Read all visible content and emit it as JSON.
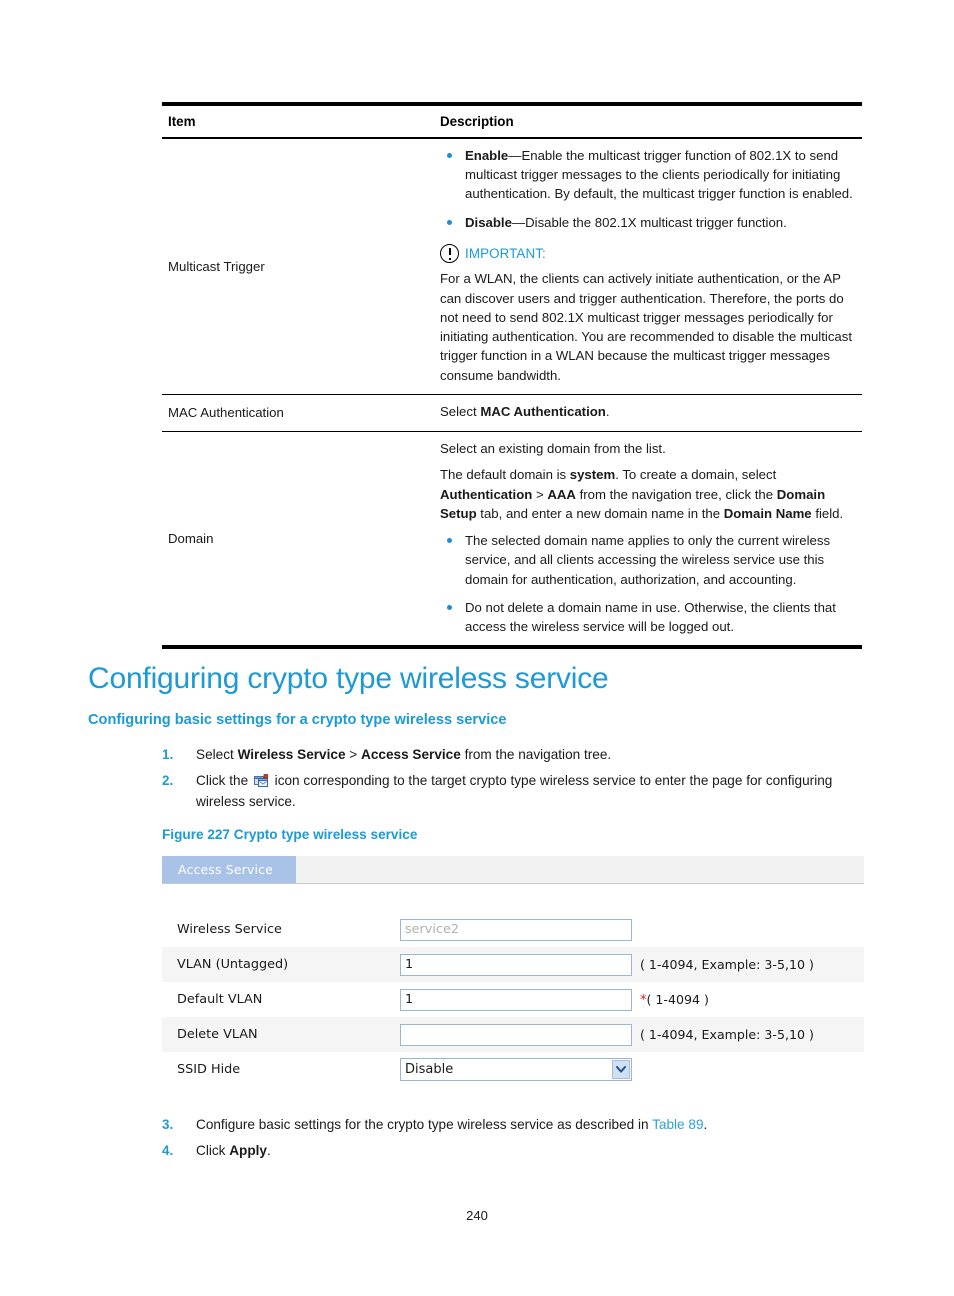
{
  "table": {
    "headers": {
      "item": "Item",
      "description": "Description"
    },
    "rows": [
      {
        "item": "Multicast Trigger",
        "bullets": [
          {
            "term": "Enable",
            "dash": "—",
            "text": "Enable the multicast trigger function of 802.1X to send multicast trigger messages to the clients periodically for initiating authentication. By default, the multicast trigger function is enabled."
          },
          {
            "term": "Disable",
            "dash": "—",
            "text": "Disable the 802.1X multicast trigger function."
          }
        ],
        "note": {
          "icon": "exclamation-circle-icon",
          "label": "IMPORTANT:",
          "text": "For a WLAN, the clients can actively initiate authentication, or the AP can discover users and trigger authentication. Therefore, the ports do not need to send 802.1X multicast trigger messages periodically for initiating authentication. You are recommended to disable the multicast trigger function in a WLAN because the multicast trigger messages consume bandwidth."
        }
      },
      {
        "item": "MAC Authentication",
        "desc_pre": "Select ",
        "desc_bold": "MAC Authentication",
        "desc_post": "."
      },
      {
        "item": "Domain",
        "para1": "Select an existing domain from the list.",
        "para2_a": "The default domain is ",
        "para2_b": "system",
        "para2_c": ". To create a domain, select ",
        "para2_d": "Authentication",
        "para2_e": " > ",
        "para2_f": "AAA",
        "para2_g": " from the navigation tree, click the ",
        "para2_h": "Domain Setup",
        "para2_i": " tab, and enter a new domain name in the ",
        "para2_j": "Domain Name",
        "para2_k": " field.",
        "bullets": [
          "The selected domain name applies to only the current wireless service, and all clients accessing the wireless service use this domain for authentication, authorization, and accounting.",
          "Do not delete a domain name in use. Otherwise, the clients that access the wireless service will be logged out."
        ]
      }
    ]
  },
  "section": {
    "heading1": "Configuring crypto type wireless service",
    "heading2": "Configuring basic settings for a crypto type wireless service",
    "figure_caption": "Figure 227 Crypto type wireless service"
  },
  "steps_top": [
    {
      "num": "1.",
      "pre": "Select ",
      "bold1": "Wireless Service",
      "mid": " > ",
      "bold2": "Access Service",
      "post": " from the navigation tree."
    },
    {
      "num": "2.",
      "pre": "Click the ",
      "icon": "wireless-service-config-icon",
      "post": " icon corresponding to the target crypto type wireless service to enter the page for configuring wireless service."
    }
  ],
  "steps_bottom": [
    {
      "num": "3.",
      "pre": "Configure basic settings for the crypto type wireless service as described in ",
      "link": "Table 89",
      "post": "."
    },
    {
      "num": "4.",
      "pre": "Click ",
      "bold1": "Apply",
      "post": "."
    }
  ],
  "screenshot": {
    "tab_label": "Access Service",
    "fields": [
      {
        "label": "Wireless Service",
        "type": "text",
        "value": "service2",
        "disabled": true,
        "hint": ""
      },
      {
        "label": "VLAN (Untagged)",
        "type": "text",
        "value": "1",
        "disabled": false,
        "hint": "( 1-4094, Example: 3-5,10 )"
      },
      {
        "label": "Default VLAN",
        "type": "text",
        "value": "1",
        "disabled": false,
        "required_mark": "*",
        "hint": "( 1-4094 )"
      },
      {
        "label": "Delete VLAN",
        "type": "text",
        "value": "",
        "disabled": false,
        "hint": "( 1-4094, Example: 3-5,10 )"
      },
      {
        "label": "SSID Hide",
        "type": "select",
        "value": "Disable",
        "hint": ""
      }
    ]
  },
  "footer": {
    "page_number": "240"
  },
  "colors": {
    "accent_blue": "#1b9ad6",
    "bullet_blue": "#1b8fd1",
    "tab_blue": "#a8c2e8",
    "required_red": "#e01b1b",
    "link_blue": "#2aa3dd"
  }
}
